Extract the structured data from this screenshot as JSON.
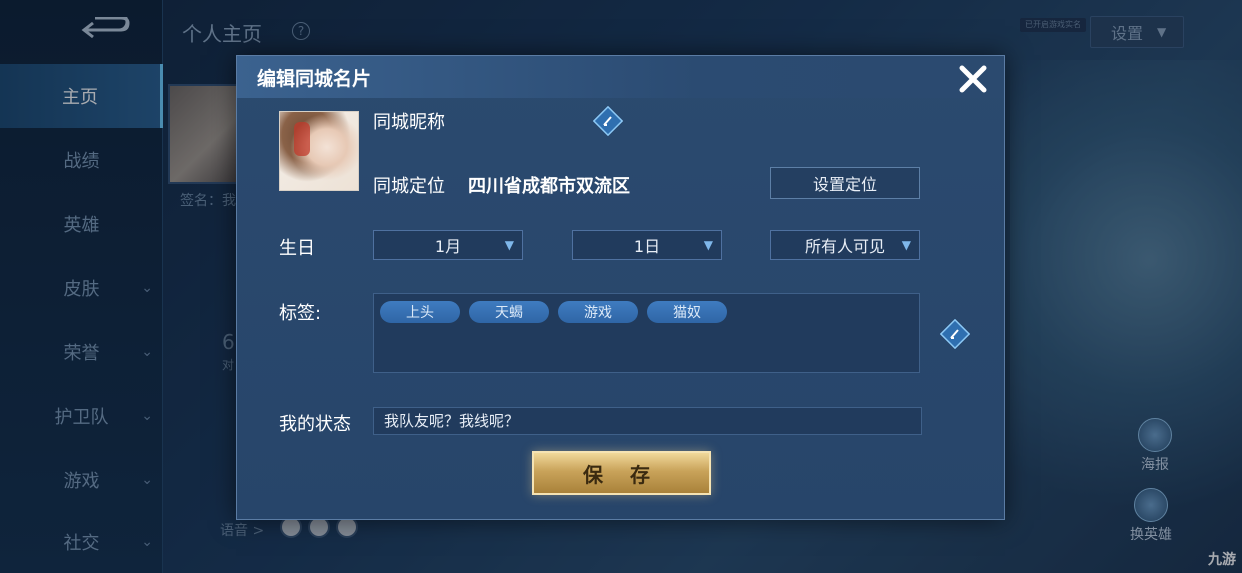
{
  "background": {
    "page_title": "个人主页",
    "settings_label": "设置",
    "top_badge": "已开启游戏实名",
    "signature": "签名：我",
    "count": "6",
    "count_label": "对",
    "voice_label": "语音 >",
    "sidebar": [
      {
        "label": "主页",
        "active": true,
        "has_chevron": false
      },
      {
        "label": "战绩",
        "active": false,
        "has_chevron": false
      },
      {
        "label": "英雄",
        "active": false,
        "has_chevron": false
      },
      {
        "label": "皮肤",
        "active": false,
        "has_chevron": true
      },
      {
        "label": "荣誉",
        "active": false,
        "has_chevron": true
      },
      {
        "label": "护卫队",
        "active": false,
        "has_chevron": true
      },
      {
        "label": "游戏",
        "active": false,
        "has_chevron": true
      },
      {
        "label": "社交",
        "active": false,
        "has_chevron": true
      }
    ],
    "side_actions": [
      {
        "label": "海报",
        "icon": "poster-icon"
      },
      {
        "label": "换英雄",
        "icon": "swap-hero-icon"
      }
    ],
    "watermark": "九游"
  },
  "modal": {
    "title": "编辑同城名片",
    "nickname_label": "同城昵称",
    "location_label": "同城定位",
    "location_value": "四川省成都市双流区",
    "set_location_button": "设置定位",
    "birthday_label": "生日",
    "month_value": "1月",
    "day_value": "1日",
    "visibility_value": "所有人可见",
    "tags_label": "标签:",
    "tags": [
      "上头",
      "天蝎",
      "游戏",
      "猫奴"
    ],
    "status_label": "我的状态",
    "status_value": "我队友呢？我线呢？",
    "save_button": "保 存"
  },
  "colors": {
    "accent": "#6fd0ff",
    "tag_blue": "#3a75b8",
    "save_gold": "#c9a35a",
    "panel": "#28476b"
  }
}
